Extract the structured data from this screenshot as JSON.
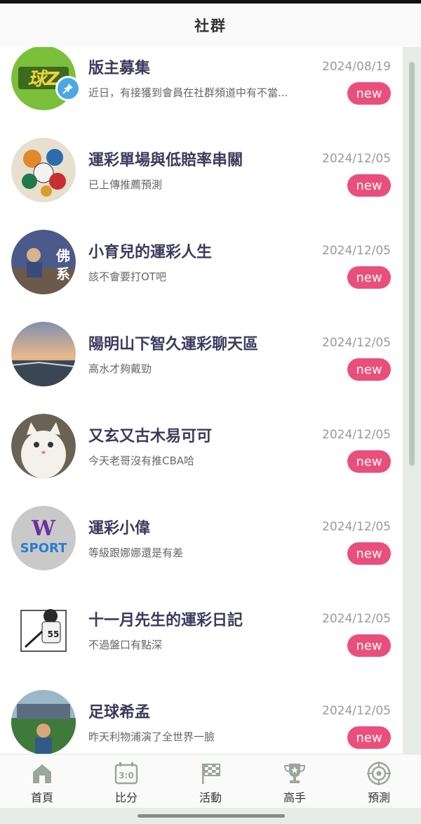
{
  "header": {
    "title": "社群"
  },
  "rows": [
    {
      "title": "版主募集",
      "subtitle": "近日，有接獲到會員在社群頻道中有不當...",
      "date": "2024/08/19",
      "badge": "new",
      "pinned": true
    },
    {
      "title": "運彩單場與低賠率串關",
      "subtitle": "已上傳推薦預測",
      "date": "2024/12/05",
      "badge": "new"
    },
    {
      "title": "小育兒的運彩人生",
      "subtitle": "該不會要打OT吧",
      "date": "2024/12/05",
      "badge": "new",
      "avatar_text": "佛系"
    },
    {
      "title": "陽明山下智久運彩聊天區",
      "subtitle": "高水才夠戴勁",
      "date": "2024/12/05",
      "badge": "new"
    },
    {
      "title": "又玄又古木易可可",
      "subtitle": "今天老哥沒有推CBA哈",
      "date": "2024/12/05",
      "badge": "new"
    },
    {
      "title": "運彩小偉",
      "subtitle": "等級跟娜娜還是有差",
      "date": "2024/12/05",
      "badge": "new",
      "avatar_text": "W SPORT"
    },
    {
      "title": "十一月先生的運彩日記",
      "subtitle": "不過盤口有點深",
      "date": "2024/12/05",
      "badge": "new",
      "avatar_text": "55"
    },
    {
      "title": "足球希孟",
      "subtitle": "昨天利物浦演了全世界一臉",
      "date": "2024/12/05",
      "badge": "new"
    }
  ],
  "nav": [
    {
      "label": "首頁",
      "icon": "home-icon"
    },
    {
      "label": "比分",
      "icon": "scoreboard-icon",
      "icon_text": "3:0"
    },
    {
      "label": "活動",
      "icon": "checkered-flag-icon"
    },
    {
      "label": "高手",
      "icon": "trophy-icon"
    },
    {
      "label": "預測",
      "icon": "target-icon"
    }
  ],
  "colors": {
    "badge": "#ea4f7c",
    "title": "#3c3a5c",
    "pin": "#4aa8e6",
    "nav_icon": "#9aa79a"
  }
}
